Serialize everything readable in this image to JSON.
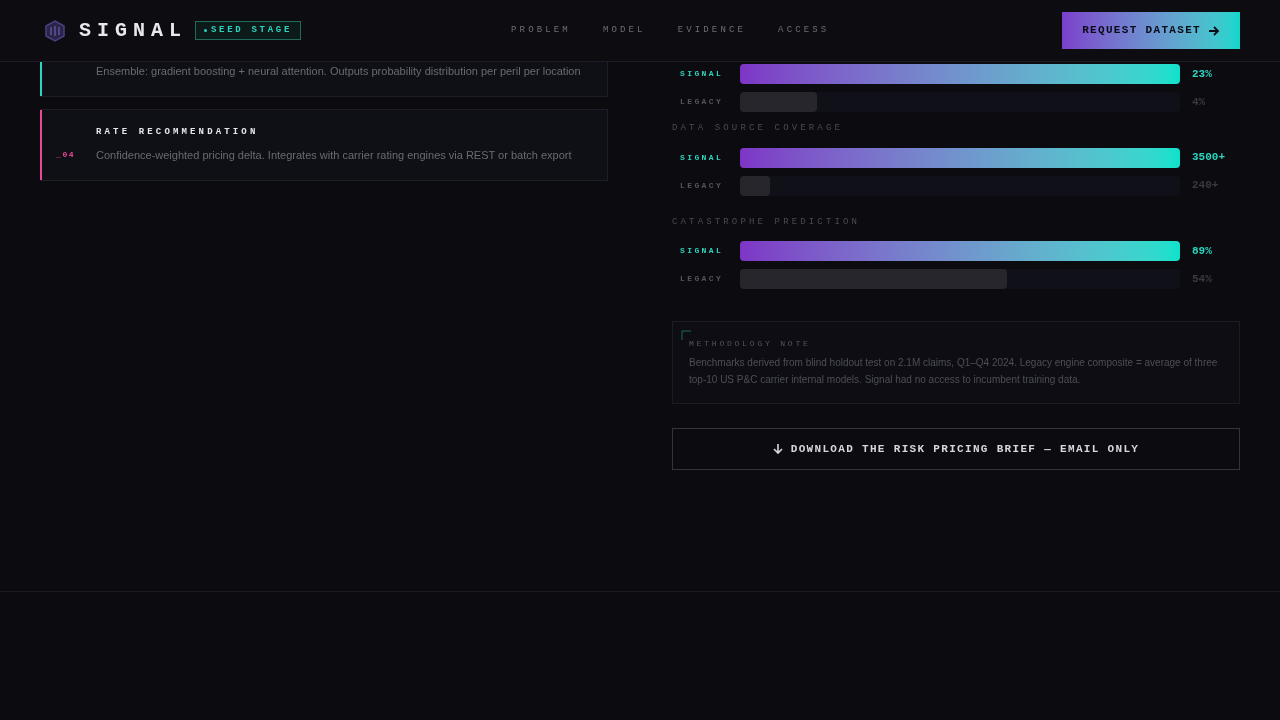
{
  "header": {
    "brand": "SIGNAL",
    "badge": "SEED STAGE",
    "nav": [
      {
        "label": "PROBLEM"
      },
      {
        "label": "MODEL"
      },
      {
        "label": "EVIDENCE"
      },
      {
        "label": "ACCESS"
      }
    ],
    "cta": "REQUEST DATASET"
  },
  "pipeline": [
    {
      "description": "Ensemble: gradient boosting + neural attention. Outputs probability distribution per peril per location",
      "color": "#2dd4bf"
    },
    {
      "index": "_04",
      "title": "RATE RECOMMENDATION",
      "description": "Confidence-weighted pricing delta. Integrates with carrier rating engines via REST or batch export",
      "color": "#ec4899"
    }
  ],
  "metrics": [
    {
      "rows": [
        {
          "kind": "signal",
          "label": "SIGNAL",
          "level": 1,
          "reading": "23%"
        },
        {
          "kind": "legacy",
          "label": "LEGACY",
          "level": 0.175,
          "reading": "4%"
        }
      ]
    },
    {
      "title": "DATA SOURCE COVERAGE",
      "rows": [
        {
          "kind": "signal",
          "label": "SIGNAL",
          "level": 1,
          "reading": "3500+"
        },
        {
          "kind": "legacy",
          "label": "LEGACY",
          "level": 0.068,
          "reading": "240+"
        }
      ]
    },
    {
      "title": "CATASTROPHE PREDICTION",
      "rows": [
        {
          "kind": "signal",
          "label": "SIGNAL",
          "level": 1,
          "reading": "89%"
        },
        {
          "kind": "legacy",
          "label": "LEGACY",
          "level": 0.607,
          "reading": "54%"
        }
      ]
    }
  ],
  "note": {
    "label": "METHODOLOGY NOTE",
    "text": "Benchmarks derived from blind holdout test on 2.1M claims, Q1–Q4 2024. Legacy engine composite = average of three top-10 US P&C carrier internal models. Signal had no access to incumbent training data."
  },
  "download": "DOWNLOAD THE RISK PRICING BRIEF — EMAIL ONLY"
}
